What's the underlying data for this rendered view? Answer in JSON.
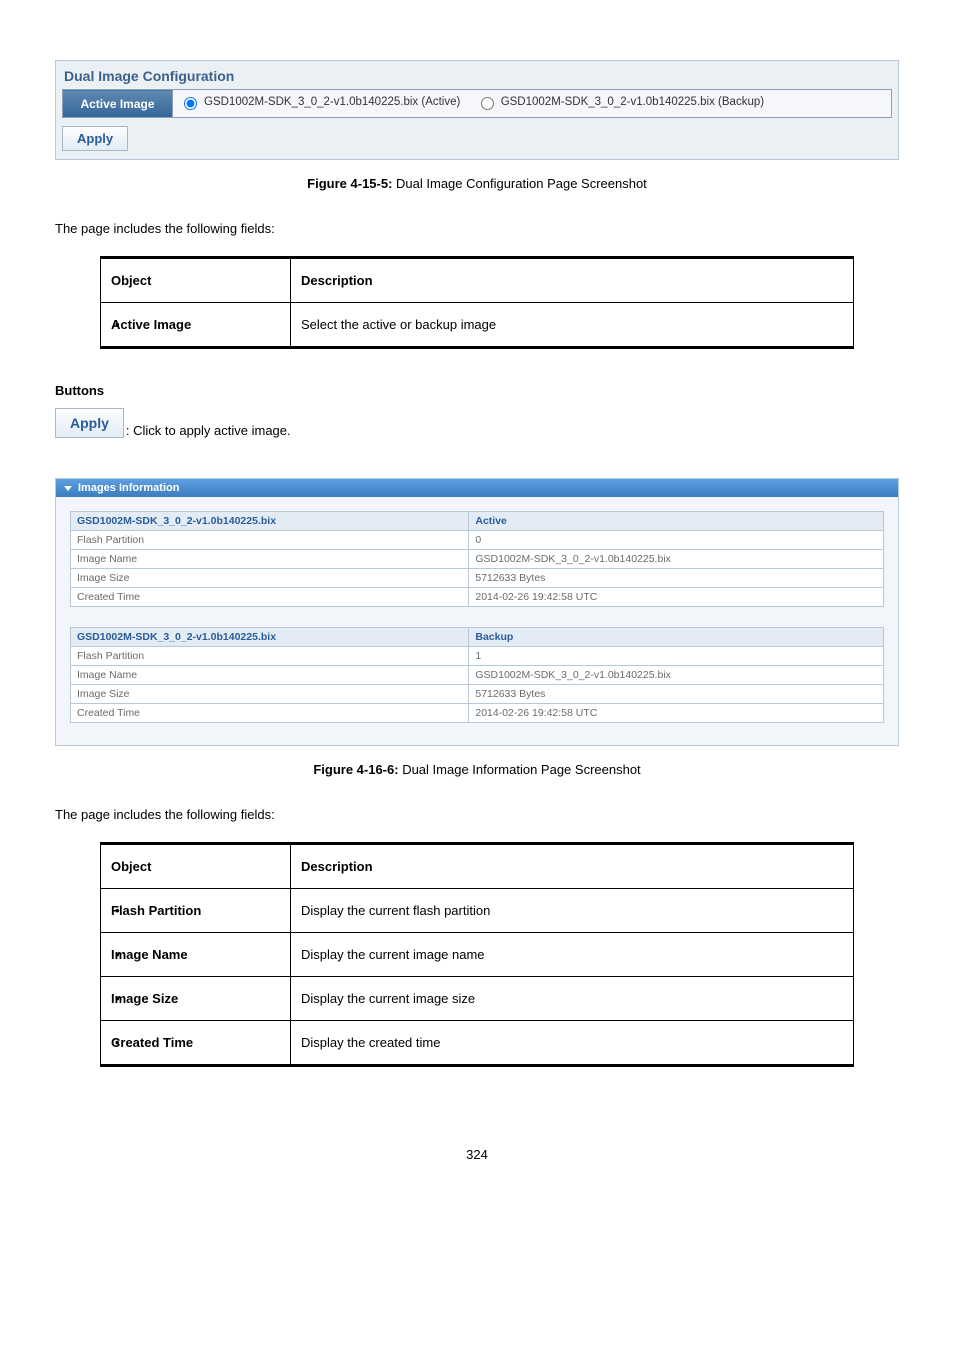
{
  "config_panel": {
    "title": "Dual Image Configuration",
    "row_label": "Active Image",
    "option1": "GSD1002M-SDK_3_0_2-v1.0b140225.bix (Active)",
    "option2": "GSD1002M-SDK_3_0_2-v1.0b140225.bix (Backup)",
    "apply": "Apply"
  },
  "caption1_bold": "Figure 4-15-5:",
  "caption1_rest": " Dual Image Configuration Page Screenshot",
  "intro": "The page includes the following fields:",
  "table1": {
    "h1": "Object",
    "h2": "Description",
    "rows": [
      {
        "obj": "Active Image",
        "desc": "Select the active or backup image"
      }
    ]
  },
  "buttons_heading": "Buttons",
  "apply_inline": "Apply",
  "apply_desc": ": Click to apply active image.",
  "info_panel": {
    "header": "Images Information",
    "img1": {
      "name_header": "GSD1002M-SDK_3_0_2-v1.0b140225.bix",
      "status": "Active",
      "k1": "Flash Partition",
      "v1": "0",
      "k2": "Image Name",
      "v2": "GSD1002M-SDK_3_0_2-v1.0b140225.bix",
      "k3": "Image Size",
      "v3": "5712633 Bytes",
      "k4": "Created Time",
      "v4": "2014-02-26 19:42:58 UTC"
    },
    "img2": {
      "name_header": "GSD1002M-SDK_3_0_2-v1.0b140225.bix",
      "status": "Backup",
      "k1": "Flash Partition",
      "v1": "1",
      "k2": "Image Name",
      "v2": "GSD1002M-SDK_3_0_2-v1.0b140225.bix",
      "k3": "Image Size",
      "v3": "5712633 Bytes",
      "k4": "Created Time",
      "v4": "2014-02-26 19:42:58 UTC"
    }
  },
  "caption2_bold": "Figure 4-16-6:",
  "caption2_rest": " Dual Image Information Page Screenshot",
  "intro2": "The page includes the following fields:",
  "table2": {
    "h1": "Object",
    "h2": "Description",
    "rows": [
      {
        "obj": "Flash Partition",
        "desc": "Display the current flash partition"
      },
      {
        "obj": "Image Name",
        "desc": "Display the current image name"
      },
      {
        "obj": "Image Size",
        "desc": "Display the current image size"
      },
      {
        "obj": "Created Time",
        "desc": "Display the created time"
      }
    ]
  },
  "page_number": "324"
}
